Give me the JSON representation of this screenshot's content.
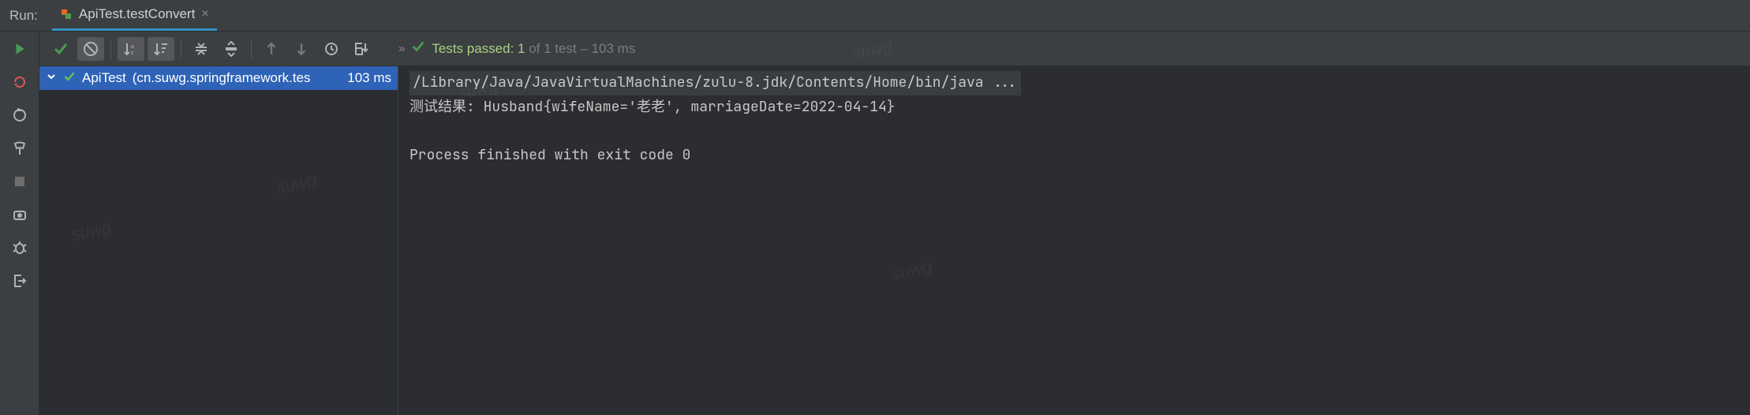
{
  "tabbar": {
    "run_label": "Run:",
    "tab_title": "ApiTest.testConvert"
  },
  "toolbar": {
    "status_passed": "Tests passed: 1",
    "status_rest": " of 1 test – 103 ms"
  },
  "tree": {
    "test_name": "ApiTest",
    "test_pkg": "(cn.suwg.springframework.tes",
    "test_time": "103 ms"
  },
  "console": {
    "cmd": "/Library/Java/JavaVirtualMachines/zulu-8.jdk/Contents/Home/bin/java ...",
    "result": "测试结果: Husband{wifeName='老老', marriageDate=2022-04-14}",
    "blank": " ",
    "exit": "Process finished with exit code 0"
  },
  "watermark": "suwg"
}
